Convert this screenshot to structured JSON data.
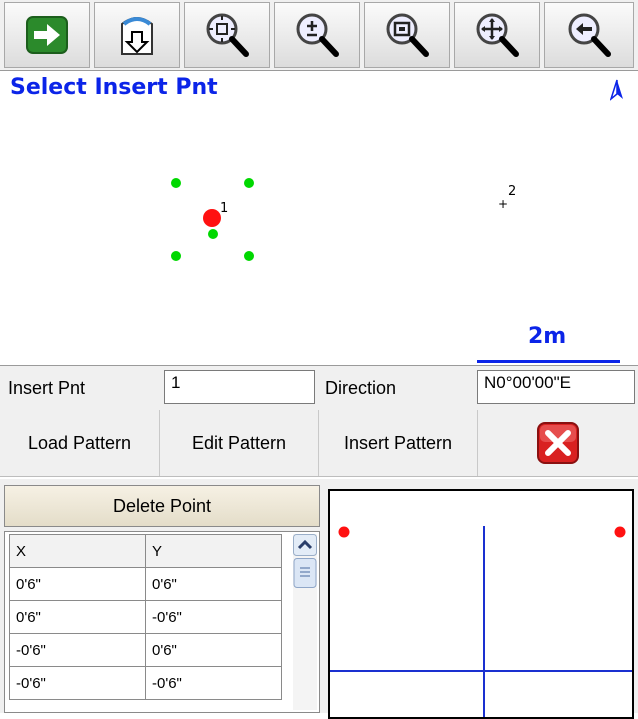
{
  "toolbar": {
    "buttons": [
      {
        "name": "exit-arrow-icon"
      },
      {
        "name": "download-icon"
      },
      {
        "name": "zoom-extents-icon"
      },
      {
        "name": "zoom-in-out-icon"
      },
      {
        "name": "zoom-window-icon"
      },
      {
        "name": "pan-icon"
      },
      {
        "name": "zoom-previous-icon"
      }
    ]
  },
  "map": {
    "title": "Select Insert Pnt",
    "point1_label": "1",
    "point2_label": "2",
    "scale_label": "2m"
  },
  "insert": {
    "point_label": "Insert Pnt",
    "point_value": "1",
    "direction_label": "Direction",
    "direction_value": "N0°00'00\"E"
  },
  "pattern_buttons": {
    "load": "Load Pattern",
    "edit": "Edit Pattern",
    "insert": "Insert Pattern"
  },
  "delete_point_label": "Delete Point",
  "table": {
    "headers": [
      "X",
      "Y"
    ],
    "rows": [
      [
        "0'6\"",
        "0'6\""
      ],
      [
        "0'6\"",
        "-0'6\""
      ],
      [
        "-0'6\"",
        "0'6\""
      ],
      [
        "-0'6\"",
        "-0'6\""
      ]
    ]
  },
  "colors": {
    "accent_blue": "#0b24e8",
    "point_red": "#ff1111",
    "point_green": "#00d800",
    "close_red": "#d92121"
  }
}
